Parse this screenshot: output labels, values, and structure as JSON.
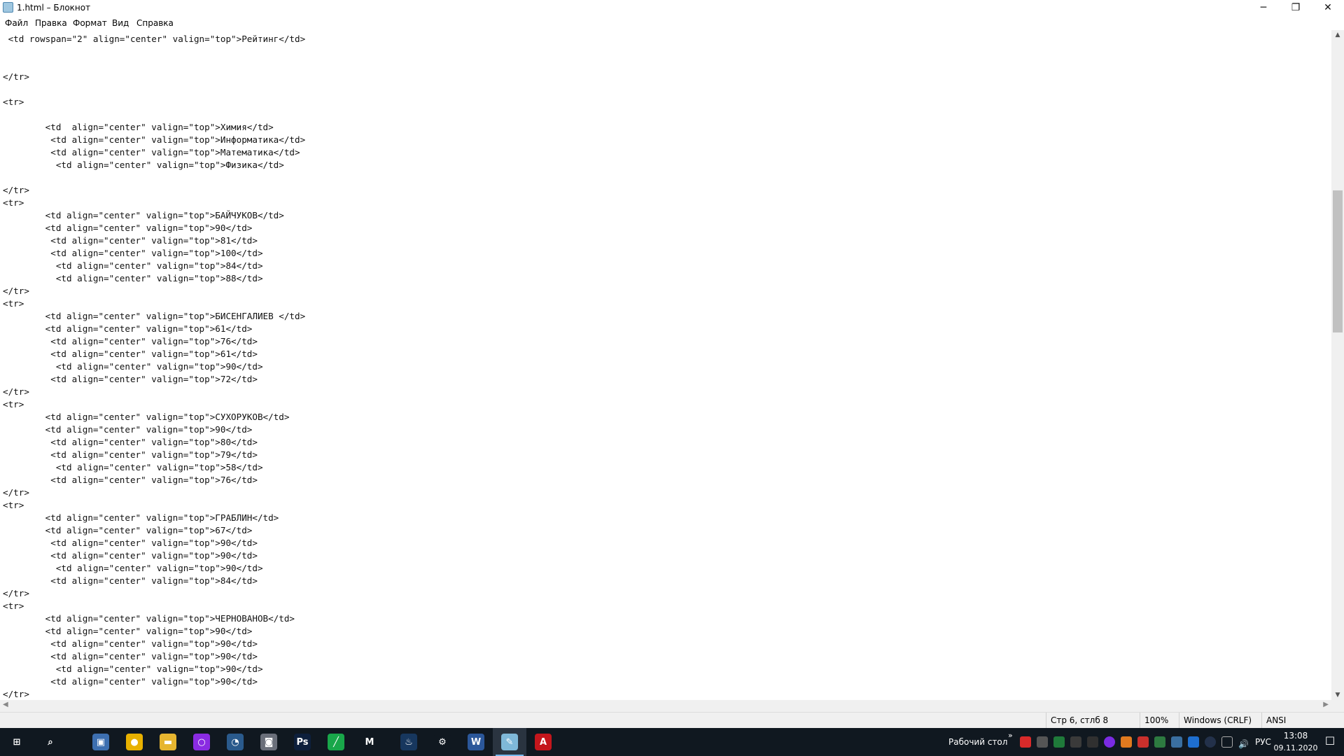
{
  "window": {
    "title": "1.html – Блокнот",
    "minimize_glyph": "─",
    "maximize_glyph": "❐",
    "close_glyph": "✕"
  },
  "menu": [
    "Файл",
    "Правка",
    "Формат",
    "Вид",
    "Справка"
  ],
  "editor": {
    "text": " <td rowspan=\"2\" align=\"center\" valign=\"top\">Рейтинг</td>\n\n\n</tr>\n\n<tr>\n\n        <td  align=\"center\" valign=\"top\">Химия</td>\n         <td align=\"center\" valign=\"top\">Информатика</td>\n         <td align=\"center\" valign=\"top\">Математика</td>\n          <td align=\"center\" valign=\"top\">Физика</td>\n\n</tr>\n<tr>\n        <td align=\"center\" valign=\"top\">БАЙЧУКОВ</td>\n        <td align=\"center\" valign=\"top\">90</td>\n         <td align=\"center\" valign=\"top\">81</td>\n         <td align=\"center\" valign=\"top\">100</td>\n          <td align=\"center\" valign=\"top\">84</td>\n          <td align=\"center\" valign=\"top\">88</td>\n</tr>\n<tr>\n        <td align=\"center\" valign=\"top\">БИСЕНГАЛИЕВ </td>\n        <td align=\"center\" valign=\"top\">61</td>\n         <td align=\"center\" valign=\"top\">76</td>\n         <td align=\"center\" valign=\"top\">61</td>\n          <td align=\"center\" valign=\"top\">90</td>\n         <td align=\"center\" valign=\"top\">72</td>\n</tr>\n<tr>\n        <td align=\"center\" valign=\"top\">СУХОРУКОВ</td>\n        <td align=\"center\" valign=\"top\">90</td>\n         <td align=\"center\" valign=\"top\">80</td>\n         <td align=\"center\" valign=\"top\">79</td>\n          <td align=\"center\" valign=\"top\">58</td>\n         <td align=\"center\" valign=\"top\">76</td>\n</tr>\n<tr>\n        <td align=\"center\" valign=\"top\">ГРАБЛИН</td>\n        <td align=\"center\" valign=\"top\">67</td>\n         <td align=\"center\" valign=\"top\">90</td>\n         <td align=\"center\" valign=\"top\">90</td>\n          <td align=\"center\" valign=\"top\">90</td>\n         <td align=\"center\" valign=\"top\">84</td>\n</tr>\n<tr>\n        <td align=\"center\" valign=\"top\">ЧЕРНОВАНОВ</td>\n        <td align=\"center\" valign=\"top\">90</td>\n         <td align=\"center\" valign=\"top\">90</td>\n         <td align=\"center\" valign=\"top\">90</td>\n          <td align=\"center\" valign=\"top\">90</td>\n         <td align=\"center\" valign=\"top\">90</td>\n</tr>",
    "scroll_position_fraction": 0.23,
    "scroll_visible_fraction": 0.22
  },
  "status": {
    "position": "Стр 6, стлб 8",
    "zoom": "100%",
    "line_endings": "Windows (CRLF)",
    "encoding": "ANSI"
  },
  "taskbar": {
    "apps": [
      {
        "name": "start",
        "glyph": "⊞",
        "color": "#101820",
        "active": false
      },
      {
        "name": "search",
        "glyph": "⌕",
        "color": "#101820",
        "active": false
      },
      {
        "name": "computer",
        "glyph": "▣",
        "color": "#3d6fb0",
        "active": false
      },
      {
        "name": "chrome",
        "glyph": "●",
        "color": "#e8b100",
        "active": false
      },
      {
        "name": "explorer",
        "glyph": "▬",
        "color": "#e6b530",
        "active": false
      },
      {
        "name": "cortana",
        "glyph": "○",
        "color": "#8a2be2",
        "active": false
      },
      {
        "name": "teamspeak",
        "glyph": "◔",
        "color": "#2a5a8c",
        "active": false
      },
      {
        "name": "discord",
        "glyph": "◙",
        "color": "#6a6f7a",
        "active": false
      },
      {
        "name": "photoshop",
        "glyph": "Ps",
        "color": "#0d1f3c",
        "active": false
      },
      {
        "name": "notes",
        "glyph": "╱",
        "color": "#19a74a",
        "active": false
      },
      {
        "name": "metro",
        "glyph": "M",
        "color": "#101820",
        "active": false
      },
      {
        "name": "steam",
        "glyph": "♨",
        "color": "#17375e",
        "active": false
      },
      {
        "name": "settings",
        "glyph": "⚙",
        "color": "#101820",
        "active": false
      },
      {
        "name": "word",
        "glyph": "W",
        "color": "#2b579a",
        "active": false
      },
      {
        "name": "notepad",
        "glyph": "✎",
        "color": "#7fb8d8",
        "active": true
      },
      {
        "name": "ai-app",
        "glyph": "A",
        "color": "#c4161c",
        "active": false
      }
    ],
    "desktop_label": "Рабочий стол",
    "desktop_chevron": "»",
    "language": "РУС",
    "time": "13:08",
    "date": "09.11.2020",
    "notification_glyph": "☐"
  }
}
